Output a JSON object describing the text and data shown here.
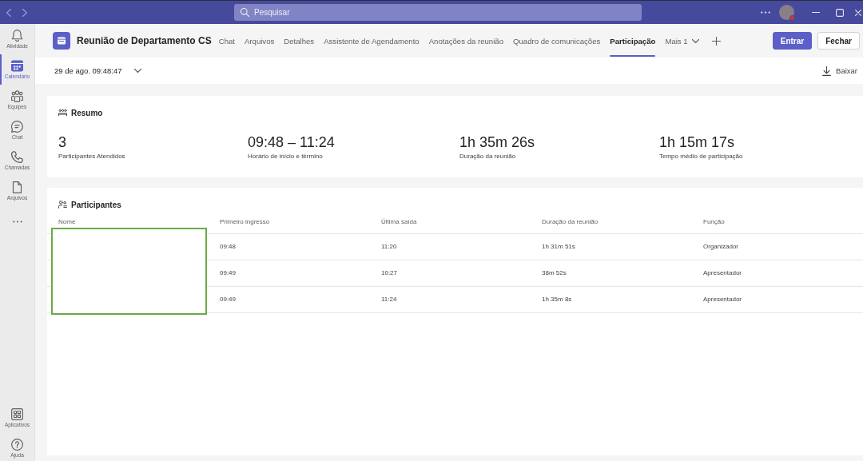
{
  "title_bar": {
    "search": {
      "placeholder": "Pesquisar"
    }
  },
  "rail": {
    "items": [
      {
        "label": "Atividade",
        "selected": false
      },
      {
        "label": "Calendário",
        "selected": true
      },
      {
        "label": "Equipes",
        "selected": false
      },
      {
        "label": "Chat",
        "selected": false
      },
      {
        "label": "Chamadas",
        "selected": false
      },
      {
        "label": "Arquivos",
        "selected": false
      }
    ],
    "bottom_items": [
      {
        "label": "Aplicativos",
        "selected": false
      },
      {
        "label": "Ajuda",
        "selected": false
      }
    ]
  },
  "meeting": {
    "title": "Reunião de Departamento CS",
    "tabs": [
      {
        "label": "Chat",
        "selected": false,
        "kind": "tab"
      },
      {
        "label": "Arquivos",
        "selected": false,
        "kind": "tab"
      },
      {
        "label": "Detalhes",
        "selected": false,
        "kind": "tab"
      },
      {
        "label": "Assistente de Agendamento",
        "selected": false,
        "kind": "tab"
      },
      {
        "label": "Anotações da reunião",
        "selected": false,
        "kind": "tab"
      },
      {
        "label": "Quadro de comunicações",
        "selected": false,
        "kind": "tab"
      },
      {
        "label": "Participação",
        "selected": true,
        "kind": "tab"
      },
      {
        "label": "Mais 1",
        "selected": false,
        "kind": "overflow"
      }
    ],
    "buttons": [
      {
        "label": "Entrar",
        "kind": "primary"
      },
      {
        "label": "Fechar",
        "kind": "secondary"
      }
    ]
  },
  "session_bar": {
    "session": "29 de ago. 09:48:47",
    "download": "Baixar"
  },
  "summary": {
    "title": "Resumo",
    "stats": [
      {
        "value": "3",
        "label": "Participantes Atendidos"
      },
      {
        "value": "09:48 – 11:24",
        "label": "Horário de início e término"
      },
      {
        "value": "1h 35m 26s",
        "label": "Duração da reunião"
      },
      {
        "value": "1h 15m 17s",
        "label": "Tempo médio de participação"
      }
    ]
  },
  "participants": {
    "title": "Participantes",
    "names_hidden": true,
    "columns": [
      "Nome",
      "Primeiro ingresso",
      "Última saída",
      "Duração da reunião",
      "Função"
    ],
    "rows": [
      {
        "first_join": "09:48",
        "last_exit": "11:20",
        "duration": "1h 31m 51s",
        "role": "Organizador"
      },
      {
        "first_join": "09:49",
        "last_exit": "10:27",
        "duration": "38m 52s",
        "role": "Apresentador"
      },
      {
        "first_join": "09:49",
        "last_exit": "11:24",
        "duration": "1h 35m 8s",
        "role": "Apresentador"
      }
    ]
  }
}
